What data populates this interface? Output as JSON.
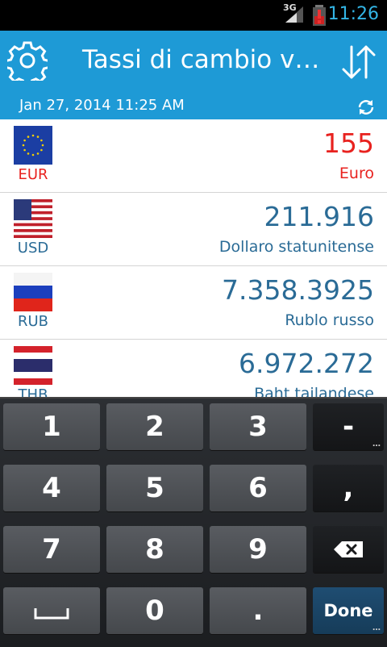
{
  "status_bar": {
    "network": "3G",
    "time": "11:26"
  },
  "app_bar": {
    "title": "Tassi di cambio v…",
    "date": "Jan 27, 2014 11:25 AM"
  },
  "currencies": [
    {
      "code": "EUR",
      "amount": "155",
      "name": "Euro",
      "active": true
    },
    {
      "code": "USD",
      "amount": "211.916",
      "name": "Dollaro statunitense",
      "active": false
    },
    {
      "code": "RUB",
      "amount": "7.358.3925",
      "name": "Rublo russo",
      "active": false
    },
    {
      "code": "THB",
      "amount": "6.972.272",
      "name": "Baht tailandese",
      "active": false
    }
  ],
  "keyboard": {
    "k1": "1",
    "k2": "2",
    "k3": "3",
    "minus": "-",
    "k4": "4",
    "k5": "5",
    "k6": "6",
    "comma": ",",
    "k7": "7",
    "k8": "8",
    "k9": "9",
    "k0": "0",
    "period": ".",
    "done": "Done"
  },
  "colors": {
    "accent": "#1e9ad6",
    "active": "#e8221f",
    "text": "#2a6b96"
  },
  "icons": [
    "gear-icon",
    "swap-icon",
    "refresh-icon",
    "backspace-icon",
    "space-icon"
  ]
}
